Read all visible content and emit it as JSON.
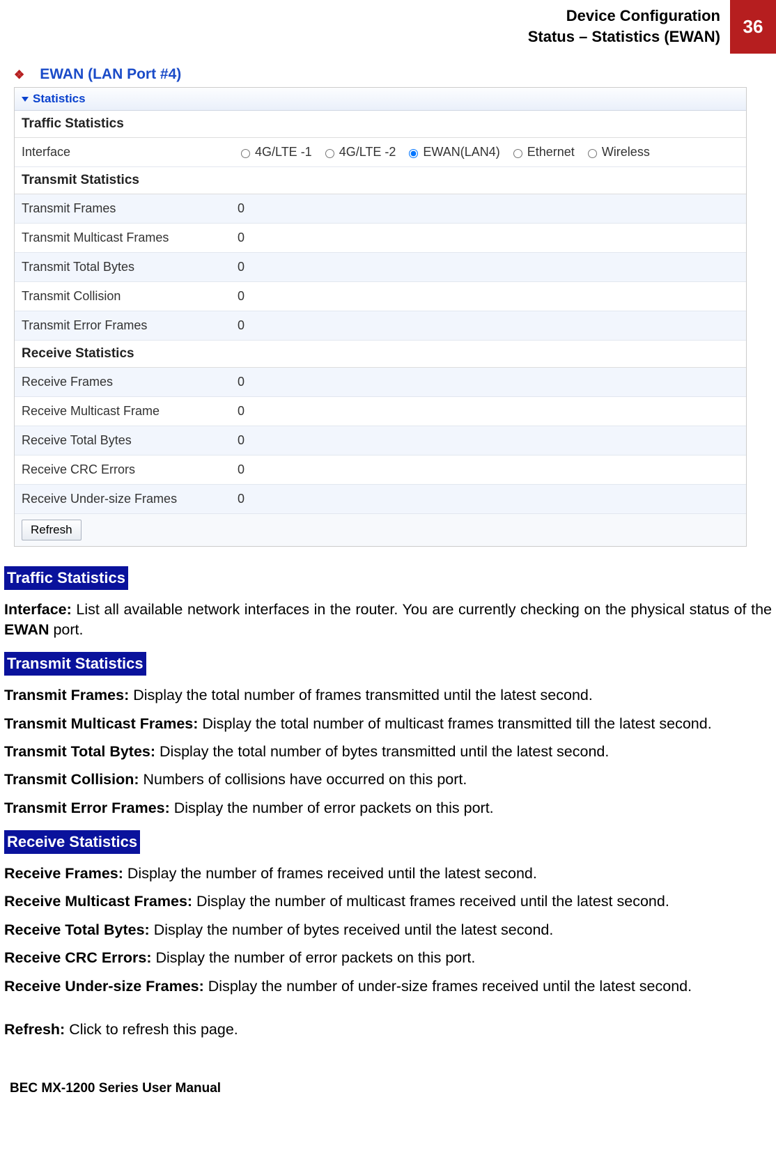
{
  "header": {
    "title_line1": "Device Configuration",
    "title_line2": "Status – Statistics (EWAN)",
    "page_number": "36"
  },
  "bullet_title": "EWAN (LAN Port #4)",
  "panel": {
    "title": "Statistics",
    "sections": {
      "traffic": "Traffic Statistics",
      "transmit": "Transmit Statistics",
      "receive": "Receive Statistics"
    },
    "interface_label": "Interface",
    "interfaces": [
      {
        "label": "4G/LTE -1",
        "checked": false
      },
      {
        "label": "4G/LTE -2",
        "checked": false
      },
      {
        "label": "EWAN(LAN4)",
        "checked": true
      },
      {
        "label": "Ethernet",
        "checked": false
      },
      {
        "label": "Wireless",
        "checked": false
      }
    ],
    "transmit_rows": [
      {
        "label": "Transmit Frames",
        "value": "0"
      },
      {
        "label": "Transmit Multicast Frames",
        "value": "0"
      },
      {
        "label": "Transmit Total Bytes",
        "value": "0"
      },
      {
        "label": "Transmit Collision",
        "value": "0"
      },
      {
        "label": "Transmit Error Frames",
        "value": "0"
      }
    ],
    "receive_rows": [
      {
        "label": "Receive Frames",
        "value": "0"
      },
      {
        "label": "Receive Multicast Frame",
        "value": "0"
      },
      {
        "label": "Receive Total Bytes",
        "value": "0"
      },
      {
        "label": "Receive CRC Errors",
        "value": "0"
      },
      {
        "label": "Receive Under-size Frames",
        "value": "0"
      }
    ],
    "refresh": "Refresh"
  },
  "doc": {
    "h_traffic": "Traffic Statistics",
    "p_interface_bold": "Interface:",
    "p_interface_text": " List all available network interfaces in the router.  You are currently checking on the physical status of the ",
    "p_interface_bold2": "EWAN",
    "p_interface_tail": " port.",
    "h_transmit": "Transmit Statistics",
    "p_tf_b": "Transmit Frames:",
    "p_tf_t": " Display the total number of frames transmitted until the latest second.",
    "p_tmf_b": "Transmit Multicast Frames:",
    "p_tmf_t": " Display the total number of multicast frames transmitted till the latest second.",
    "p_ttb_b": "Transmit Total Bytes:",
    "p_ttb_t": " Display the total number of bytes transmitted until the latest second.",
    "p_tc_b": "Transmit Collision:",
    "p_tc_t": " Numbers of collisions have occurred on this port.",
    "p_tef_b": "Transmit Error Frames:",
    "p_tef_t": " Display the number of error packets on this port.",
    "h_receive": "Receive Statistics",
    "p_rf_b": "Receive Frames:",
    "p_rf_t": " Display the number of frames received until the latest second.",
    "p_rmf_b": "Receive Multicast Frames:",
    "p_rmf_t": " Display the number of multicast frames received until the latest second.",
    "p_rtb_b": "Receive Total Bytes:",
    "p_rtb_t": " Display the number of bytes received until the latest second.",
    "p_rce_b": "Receive CRC Errors:",
    "p_rce_t": " Display the number of error packets on this port.",
    "p_ruf_b": "Receive Under-size Frames:",
    "p_ruf_t": " Display the number of under-size frames received until the latest second.",
    "p_refresh_b": "Refresh:",
    "p_refresh_t": " Click to refresh this page."
  },
  "footer": "BEC MX-1200 Series User Manual"
}
